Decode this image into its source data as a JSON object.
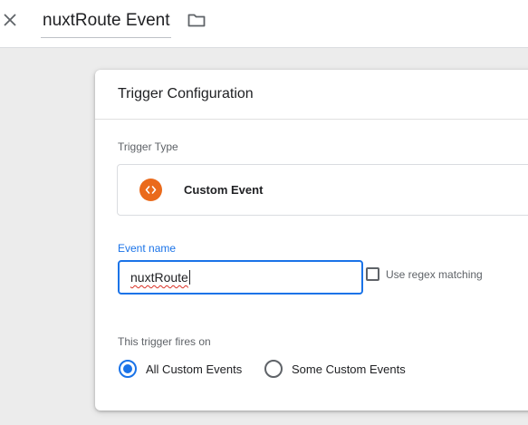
{
  "header": {
    "title": "nuxtRoute Event",
    "close_icon": "close-icon",
    "folder_icon": "folder-icon"
  },
  "card": {
    "title": "Trigger Configuration",
    "trigger_type": {
      "label": "Trigger Type",
      "value": "Custom Event",
      "icon": "code-brackets-icon",
      "icon_color": "#ea6a1b"
    },
    "event_name": {
      "label": "Event name",
      "value": "nuxtRoute"
    },
    "regex": {
      "label": "Use regex matching",
      "checked": false
    },
    "fires_on": {
      "label": "This trigger fires on",
      "options": [
        {
          "label": "All Custom Events",
          "selected": true
        },
        {
          "label": "Some Custom Events",
          "selected": false
        }
      ]
    }
  },
  "colors": {
    "accent": "#1a73e8",
    "background": "#ececec",
    "error_underline": "#d93025"
  }
}
